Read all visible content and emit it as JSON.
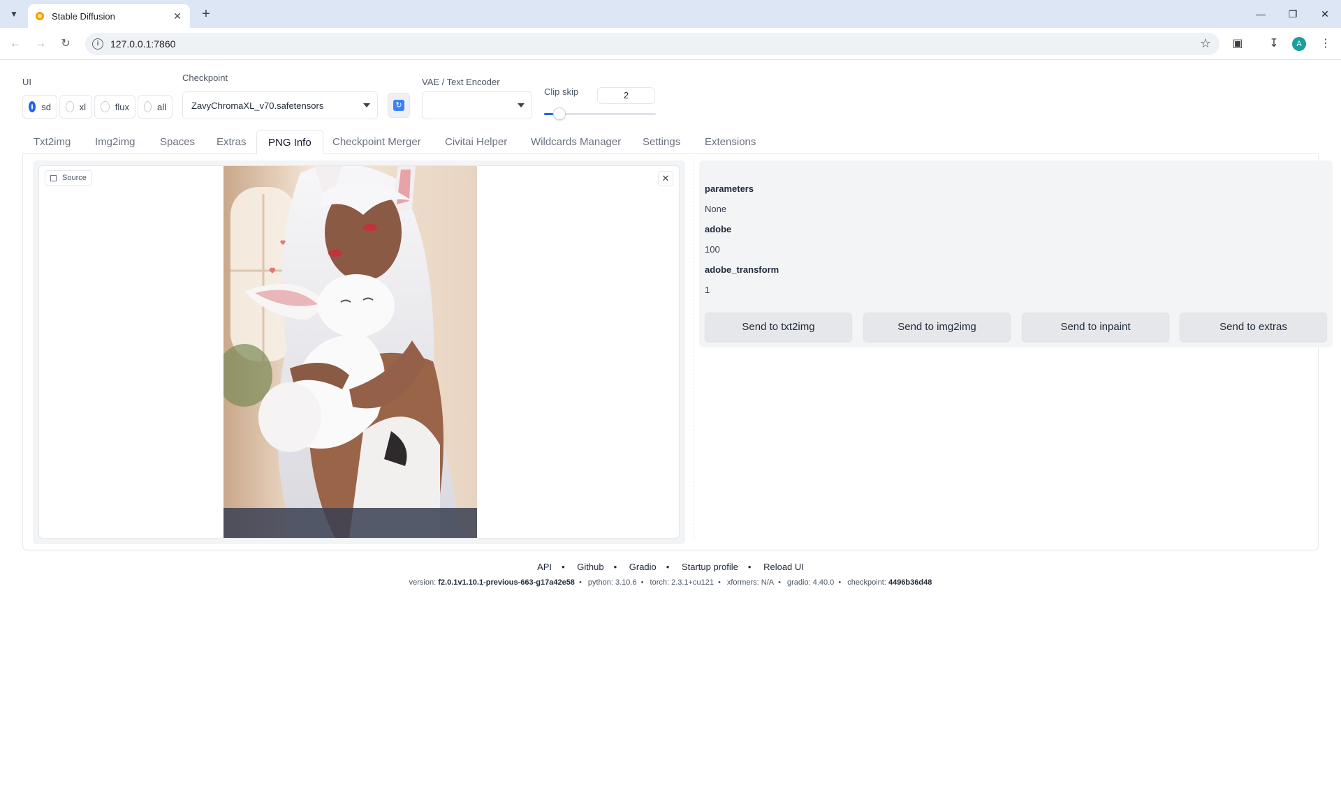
{
  "browser": {
    "tab_title": "Stable Diffusion",
    "url": "127.0.0.1:7860",
    "avatar_letter": "A"
  },
  "controls": {
    "ui_label": "UI",
    "ui_options": [
      "sd",
      "xl",
      "flux",
      "all"
    ],
    "ui_selected": "sd",
    "checkpoint_label": "Checkpoint",
    "checkpoint_value": "ZavyChromaXL_v70.safetensors",
    "vae_label": "VAE / Text Encoder",
    "vae_value": "",
    "clip_skip_label": "Clip skip",
    "clip_skip_value": "2",
    "clip_skip_fraction": 0.08
  },
  "tabs": [
    "Txt2img",
    "Img2img",
    "Spaces",
    "Extras",
    "PNG Info",
    "Checkpoint Merger",
    "Civitai Helper",
    "Wildcards Manager",
    "Settings",
    "Extensions"
  ],
  "active_tab": "PNG Info",
  "png_info": {
    "source_label": "Source",
    "fields": [
      {
        "key": "parameters",
        "value": "None"
      },
      {
        "key": "adobe",
        "value": "100"
      },
      {
        "key": "adobe_transform",
        "value": "1"
      }
    ],
    "buttons": [
      "Send to txt2img",
      "Send to img2img",
      "Send to inpaint",
      "Send to extras"
    ]
  },
  "footer": {
    "links": [
      "API",
      "Github",
      "Gradio",
      "Startup profile",
      "Reload UI"
    ],
    "version_label": "version:",
    "version": "f2.0.1v1.10.1-previous-663-g17a42e58",
    "python": "python: 3.10.6",
    "torch": "torch: 2.3.1+cu121",
    "xformers": "xformers: N/A",
    "gradio": "gradio: 4.40.0",
    "checkpoint_label": "checkpoint:",
    "checkpoint": "4496b36d48"
  },
  "colors": {
    "accent": "#2563eb",
    "tab_strip": "#dde6f5",
    "panel_bg": "#f3f4f6",
    "button_bg": "#e5e7eb"
  }
}
